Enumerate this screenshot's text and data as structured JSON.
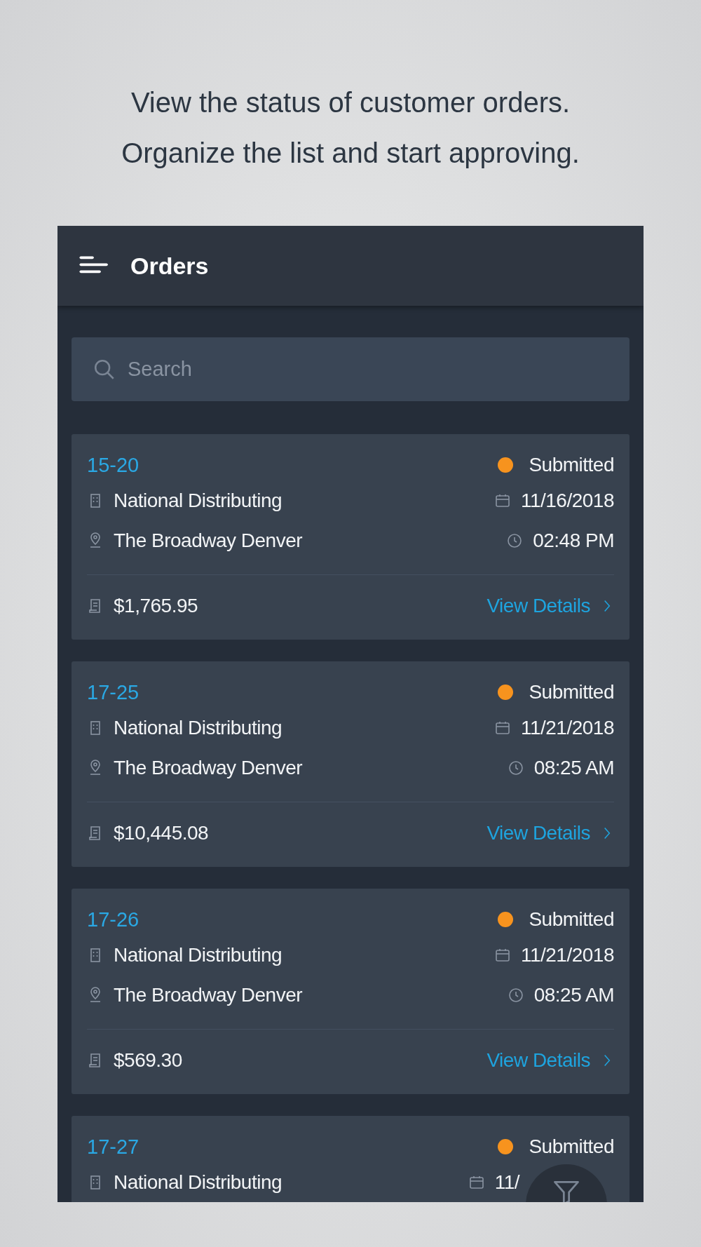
{
  "caption": [
    "View the status of customer orders.",
    "Organize the list and start approving."
  ],
  "app_bar": {
    "title": "Orders"
  },
  "search": {
    "placeholder": "Search"
  },
  "orders": [
    {
      "number": "15-20",
      "status": "Submitted",
      "color": "#f7931e",
      "customer": "National Distributing",
      "date": "11/16/2018",
      "location": "The Broadway Denver",
      "time": "02:48 PM",
      "total": "$1,765.95",
      "link": "View Details"
    },
    {
      "number": "17-25",
      "status": "Submitted",
      "color": "#f7931e",
      "customer": "National Distributing",
      "date": "11/21/2018",
      "location": "The Broadway Denver",
      "time": "08:25 AM",
      "total": "$10,445.08",
      "link": "View Details"
    },
    {
      "number": "17-26",
      "status": "Submitted",
      "color": "#f7931e",
      "customer": "National Distributing",
      "date": "11/21/2018",
      "location": "The Broadway Denver",
      "time": "08:25 AM",
      "total": "$569.30",
      "link": "View Details"
    },
    {
      "number": "17-27",
      "status": "Submitted",
      "color": "#f7931e",
      "customer": "National Distributing",
      "date": "11/"
    }
  ]
}
